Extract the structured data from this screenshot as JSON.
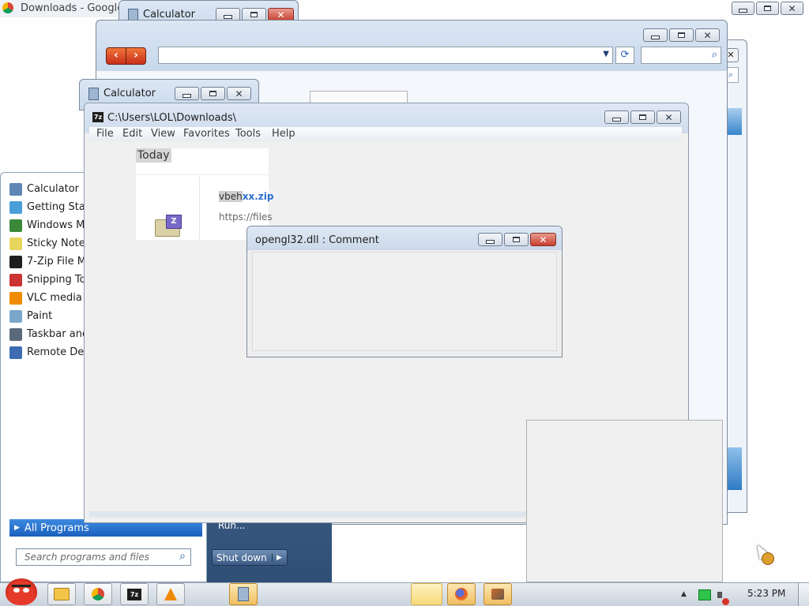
{
  "chrome_window": {
    "title": "Downloads - Google"
  },
  "calculator_top": {
    "title": "Calculator"
  },
  "calculator_back": {
    "title": "Calculator"
  },
  "browser": {
    "address_value": "",
    "search_value": ""
  },
  "sevenzip": {
    "title": "C:\\Users\\LOL\\Downloads\\",
    "menu": [
      "File",
      "Edit",
      "View",
      "Favorites",
      "Tools",
      "Help"
    ]
  },
  "downloads_panel": {
    "section_label": "Today",
    "file_name_prefix": "vbeh",
    "file_name_suffix": "xx.zip",
    "file_url": "https://files"
  },
  "comment_dialog": {
    "title": "opengl32.dll : Comment"
  },
  "start_menu": {
    "programs": [
      {
        "label": "Calculator",
        "icon": "calculator-icon",
        "color": "#5f87b5"
      },
      {
        "label": "Getting Sta",
        "icon": "getting-started-icon",
        "color": "#4a9fd8"
      },
      {
        "label": "Windows M",
        "icon": "media-center-icon",
        "color": "#3a8a3a"
      },
      {
        "label": "Sticky Note",
        "icon": "sticky-notes-icon",
        "color": "#e8d65c"
      },
      {
        "label": "7-Zip File M",
        "icon": "7zip-icon",
        "color": "#1e1e1e"
      },
      {
        "label": "Snipping To",
        "icon": "snipping-tool-icon",
        "color": "#c33"
      },
      {
        "label": "VLC media",
        "icon": "vlc-icon",
        "color": "#f08a00"
      },
      {
        "label": "Paint",
        "icon": "paint-icon",
        "color": "#7aa7c9"
      },
      {
        "label": "Taskbar and",
        "icon": "taskbar-icon",
        "color": "#5a6a7a"
      },
      {
        "label": "Remote Des",
        "icon": "remote-desktop-icon",
        "color": "#3e6db3"
      }
    ],
    "all_programs": "All Programs",
    "run": "Run...",
    "search_placeholder": "Search programs and files",
    "shutdown": "Shut down"
  },
  "taskbar": {
    "clock": "5:23 PM",
    "buttons": [
      "start-orb",
      "explorer",
      "chrome",
      "7zip",
      "vlc",
      "calculator",
      "blank",
      "firefox",
      "bin"
    ]
  },
  "colors": {
    "accent": "#3a7bd5",
    "selection": "#1e6fd0"
  }
}
